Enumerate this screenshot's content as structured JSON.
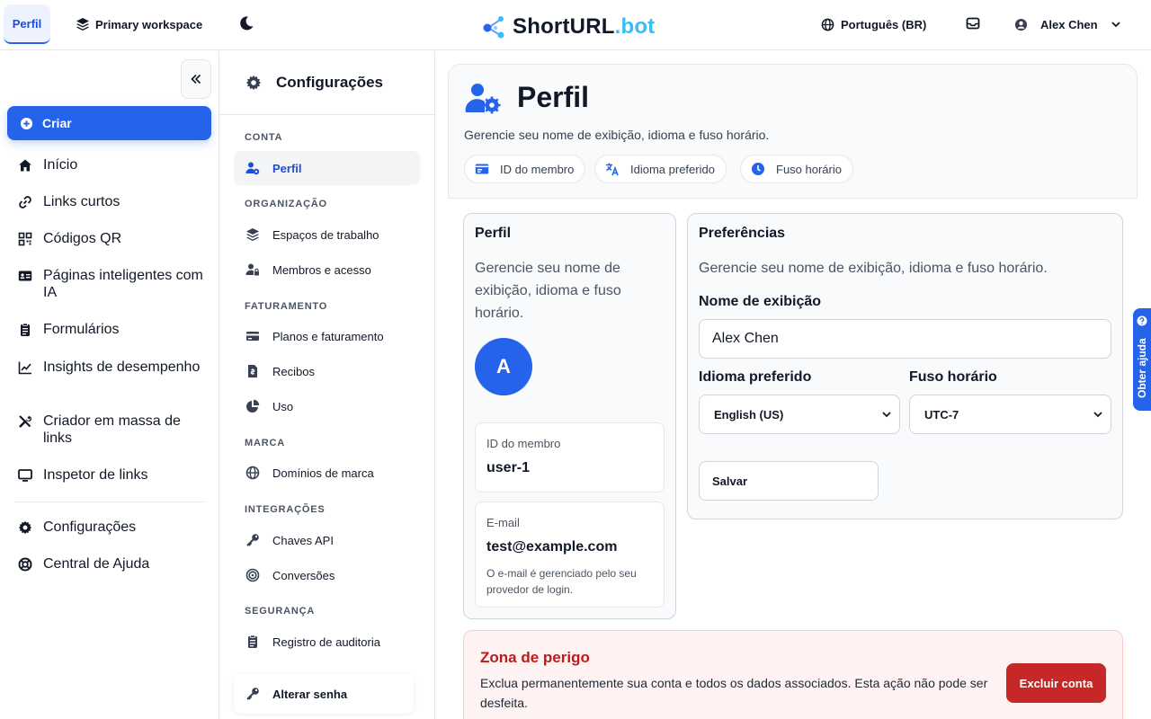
{
  "topbar": {
    "active_tab": "Perfil",
    "workspace": "Primary workspace",
    "logo_main": "ShortURL",
    "logo_accent": ".bot",
    "language": "Português (BR)",
    "user_name": "Alex Chen"
  },
  "sidebar": {
    "create_label": "Criar",
    "items": [
      {
        "label": "Início",
        "icon": "home-icon"
      },
      {
        "label": "Links curtos",
        "icon": "link-icon"
      },
      {
        "label": "Códigos QR",
        "icon": "qr-icon"
      },
      {
        "label": "Páginas inteligentes com IA",
        "icon": "id-card-icon"
      },
      {
        "label": "Formulários",
        "icon": "clipboard-icon"
      },
      {
        "label": "Insights de desempenho",
        "icon": "chart-line-icon"
      },
      {
        "label": "Criador em massa de links",
        "icon": "tools-icon"
      },
      {
        "label": "Inspetor de links",
        "icon": "monitor-icon"
      },
      {
        "label": "Configurações",
        "icon": "gear-icon"
      },
      {
        "label": "Central de Ajuda",
        "icon": "lifebuoy-icon"
      }
    ]
  },
  "settings": {
    "title": "Configurações",
    "sections": {
      "conta": "CONTA",
      "organizacao": "ORGANIZAÇÃO",
      "faturamento": "FATURAMENTO",
      "marca": "MARCA",
      "integracoes": "INTEGRAÇÕES",
      "seguranca": "SEGURANÇA"
    },
    "items": {
      "perfil": "Perfil",
      "espacos": "Espaços de trabalho",
      "membros": "Membros e acesso",
      "planos": "Planos e faturamento",
      "recibos": "Recibos",
      "uso": "Uso",
      "dominios": "Domínios de marca",
      "chaves": "Chaves API",
      "conversoes": "Conversões",
      "auditoria": "Registro de auditoria",
      "alterar_senha": "Alterar senha"
    }
  },
  "main": {
    "title": "Perfil",
    "description": "Gerencie seu nome de exibição, idioma e fuso horário.",
    "pills": [
      "ID do membro",
      "Idioma preferido",
      "Fuso horário"
    ],
    "profile_card": {
      "title": "Perfil",
      "description": "Gerencie seu nome de exibição, idioma e fuso horário.",
      "avatar_letter": "A",
      "member_id_label": "ID do membro",
      "member_id_value": "user-1",
      "email_label": "E-mail",
      "email_value": "test@example.com",
      "email_note": "O e-mail é gerenciado pelo seu provedor de login."
    },
    "preferences": {
      "title": "Preferências",
      "description": "Gerencie seu nome de exibição, idioma e fuso horário.",
      "display_name_label": "Nome de exibição",
      "display_name_value": "Alex Chen",
      "language_label": "Idioma preferido",
      "language_value": "English (US)",
      "timezone_label": "Fuso horário",
      "timezone_value": "UTC-7",
      "save_label": "Salvar"
    },
    "danger": {
      "title": "Zona de perigo",
      "description": "Exclua permanentemente sua conta e todos os dados associados. Esta ação não pode ser desfeita.",
      "button": "Excluir conta"
    }
  },
  "help_tab": "Obter ajuda",
  "colors": {
    "primary": "#2563eb",
    "danger": "#c62828",
    "logo_accent": "#38bdf8"
  }
}
